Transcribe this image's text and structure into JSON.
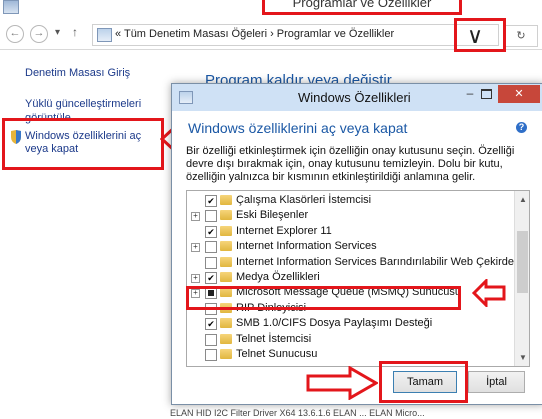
{
  "window": {
    "title": "Programlar ve Özellikler"
  },
  "address": {
    "back": "←",
    "forward": "→",
    "recent": "▾",
    "up": "↑",
    "path_text": "«  Tüm Denetim Masası Öğeleri  ›  Programlar ve Özellikler",
    "dropdown": "∨",
    "refresh": "↻"
  },
  "sidebar": {
    "items": [
      {
        "label": "Denetim Masası Giriş"
      },
      {
        "label": "Yüklü güncelleştirmeleri görüntüle"
      },
      {
        "label": "Windows özelliklerini aç veya kapat"
      }
    ]
  },
  "main": {
    "heading": "Program kaldır veya değiştir"
  },
  "dialog": {
    "title": "Windows Özellikleri",
    "minimize": "–",
    "close": "✕",
    "heading": "Windows özelliklerini aç veya kapat",
    "help": "?",
    "description": "Bir özelliği etkinleştirmek için özelliğin onay kutusunu seçin. Özelliği devre dışı bırakmak için, onay kutusunu temizleyin. Dolu bir kutu, özelliğin yalnızca bir kısmının etkinleştirildiği anlamına gelir.",
    "features": [
      {
        "label": "Çalışma Klasörleri İstemcisi",
        "state": "checked",
        "expandable": false
      },
      {
        "label": "Eski Bileşenler",
        "state": "unchecked",
        "expandable": true
      },
      {
        "label": "Internet Explorer 11",
        "state": "checked",
        "expandable": false
      },
      {
        "label": "Internet Information Services",
        "state": "unchecked",
        "expandable": true
      },
      {
        "label": "Internet Information Services Barındırılabilir Web Çekirdeği",
        "state": "unchecked",
        "expandable": false
      },
      {
        "label": "Medya Özellikleri",
        "state": "checked",
        "expandable": true
      },
      {
        "label": "Microsoft Message Queue (MSMQ) Sunucusu",
        "state": "partial",
        "expandable": true
      },
      {
        "label": "RIP Dinleyicisi",
        "state": "unchecked",
        "expandable": false
      },
      {
        "label": "SMB 1.0/CIFS Dosya Paylaşımı Desteği",
        "state": "checked",
        "expandable": false
      },
      {
        "label": "Telnet İstemcisi",
        "state": "unchecked",
        "expandable": false
      },
      {
        "label": "Telnet Sunucusu",
        "state": "unchecked",
        "expandable": false
      }
    ],
    "ok_label": "Tamam",
    "cancel_label": "İptal"
  },
  "colors": {
    "highlight_red": "#e3161b",
    "link_blue": "#1c3a8a",
    "heading_blue": "#1b58a5"
  },
  "bottom_text": "ELAN HID I2C Filter Driver X64 13.6.1.6   ELAN ...   ELAN Micro..."
}
